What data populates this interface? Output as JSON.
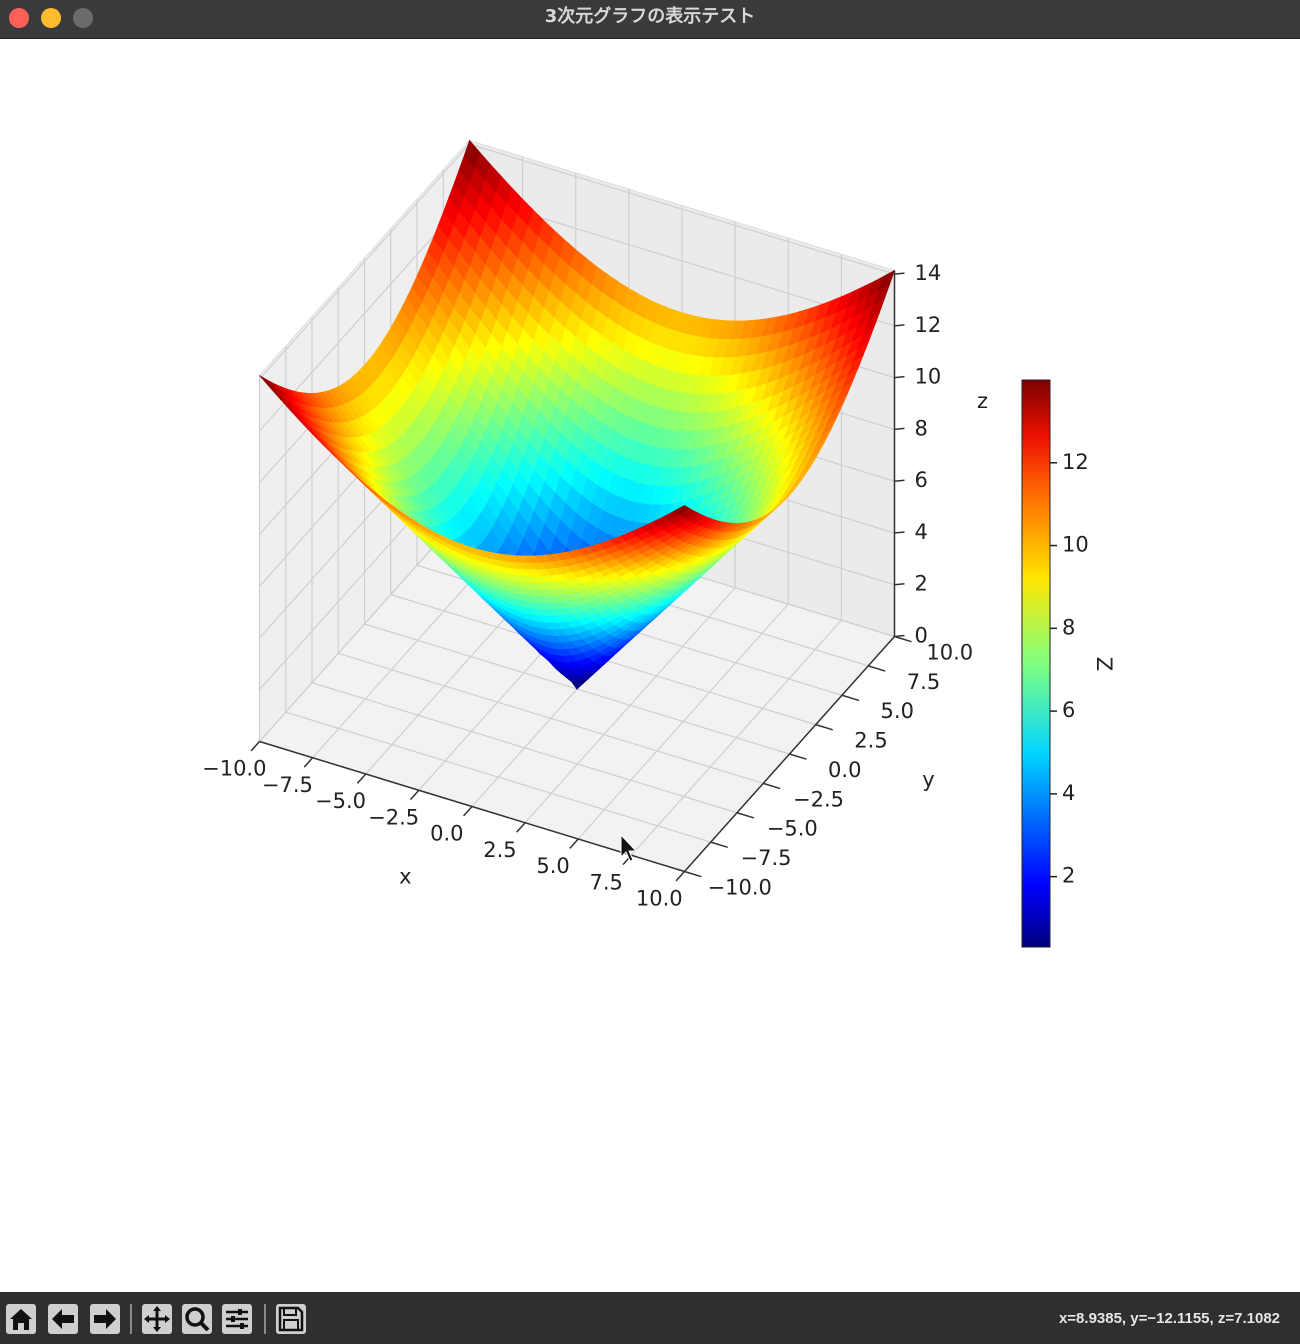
{
  "window": {
    "title": "3次元グラフの表示テスト"
  },
  "toolbar": {
    "buttons": [
      {
        "name": "home-icon"
      },
      {
        "name": "back-icon"
      },
      {
        "name": "forward-icon"
      },
      {
        "name": "pan-icon"
      },
      {
        "name": "zoom-icon"
      },
      {
        "name": "configure-subplots-icon"
      },
      {
        "name": "save-icon"
      }
    ],
    "coords": "x=8.9385, y=−12.1155, z=7.1082"
  },
  "chart_data": {
    "type": "surface",
    "function": "z = sqrt(x^2 + y^2)",
    "x_range": [
      -10,
      10
    ],
    "y_range": [
      -10,
      10
    ],
    "xlabel": "x",
    "ylabel": "y",
    "zlabel": "z",
    "x_ticks": [
      "−10.0",
      "−7.5",
      "−5.0",
      "−2.5",
      "0.0",
      "2.5",
      "5.0",
      "7.5",
      "10.0"
    ],
    "y_ticks": [
      "−10.0",
      "−7.5",
      "−5.0",
      "−2.5",
      "0.0",
      "2.5",
      "5.0",
      "7.5",
      "10.0"
    ],
    "z_ticks": [
      "0",
      "2",
      "4",
      "6",
      "8",
      "10",
      "12",
      "14"
    ],
    "zlim": [
      0,
      14.14
    ],
    "colormap": "jet",
    "colorbar": {
      "label": "Z",
      "ticks": [
        "2",
        "4",
        "6",
        "8",
        "10",
        "12"
      ],
      "range": [
        0.3,
        14.0
      ],
      "colors": [
        "#00007f",
        "#0000ff",
        "#007fff",
        "#00ffff",
        "#7fff7f",
        "#ffff00",
        "#ff7f00",
        "#ff0000",
        "#7f0000"
      ]
    },
    "grid": true
  }
}
